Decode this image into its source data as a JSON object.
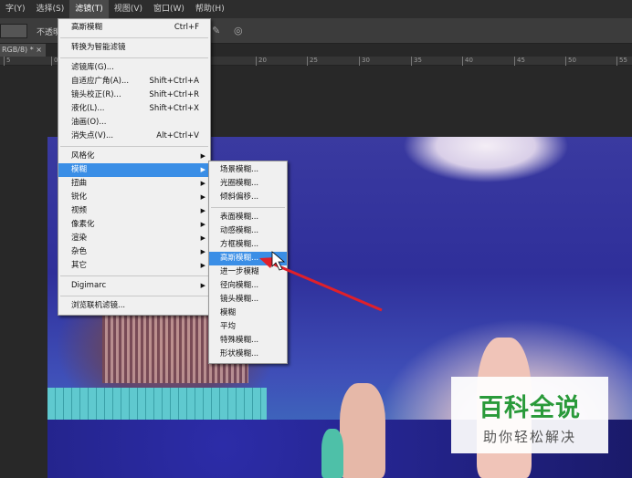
{
  "menubar": {
    "items": [
      "字(Y)",
      "选择(S)",
      "滤镜(T)",
      "视图(V)",
      "窗口(W)",
      "帮助(H)"
    ]
  },
  "options": {
    "opacity_label": "不透明"
  },
  "doc_tab": {
    "label": "RGB/8) *",
    "close": "×"
  },
  "ruler": {
    "ticks": [
      "0",
      "5",
      "20",
      "25",
      "30",
      "35",
      "40",
      "45",
      "50",
      "55"
    ]
  },
  "filter_menu": {
    "items": [
      {
        "label": "高斯模糊",
        "shortcut": "Ctrl+F"
      },
      {
        "label": "转换为智能滤镜"
      },
      {
        "label": "滤镜库(G)..."
      },
      {
        "label": "自适应广角(A)...",
        "shortcut": "Shift+Ctrl+A"
      },
      {
        "label": "镜头校正(R)...",
        "shortcut": "Shift+Ctrl+R"
      },
      {
        "label": "液化(L)...",
        "shortcut": "Shift+Ctrl+X"
      },
      {
        "label": "油画(O)..."
      },
      {
        "label": "消失点(V)...",
        "shortcut": "Alt+Ctrl+V"
      },
      {
        "label": "风格化"
      },
      {
        "label": "模糊"
      },
      {
        "label": "扭曲"
      },
      {
        "label": "锐化"
      },
      {
        "label": "视频"
      },
      {
        "label": "像素化"
      },
      {
        "label": "渲染"
      },
      {
        "label": "杂色"
      },
      {
        "label": "其它"
      },
      {
        "label": "Digimarc"
      },
      {
        "label": "浏览联机滤镜..."
      }
    ]
  },
  "blur_menu": {
    "items": [
      "场景模糊...",
      "光圈模糊...",
      "倾斜偏移...",
      "表面模糊...",
      "动感模糊...",
      "方框模糊...",
      "高斯模糊...",
      "进一步模糊",
      "径向模糊...",
      "镜头模糊...",
      "模糊",
      "平均",
      "特殊模糊...",
      "形状模糊..."
    ]
  },
  "watermark": {
    "title": "百科全说",
    "subtitle": "助你轻松解决"
  },
  "colors": {
    "highlight": "#3a8ee6",
    "arrow": "#e0202a",
    "watermark_green": "#2a9a3a"
  }
}
